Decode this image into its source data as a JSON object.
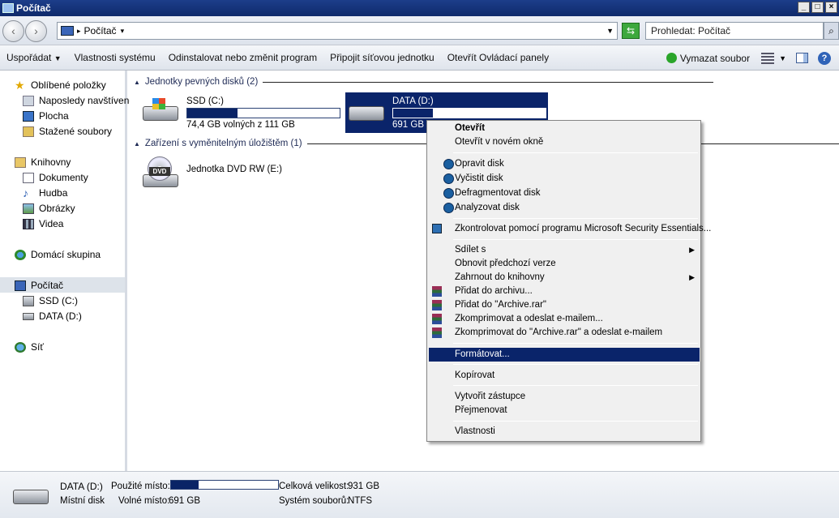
{
  "window": {
    "title": "Počítač"
  },
  "address": {
    "location": "Počítač",
    "search_placeholder": "Prohledat: Počítač"
  },
  "toolbar": {
    "organize": "Uspořádat",
    "system_props": "Vlastnosti systému",
    "uninstall": "Odinstalovat nebo změnit program",
    "map_drive": "Připojit síťovou jednotku",
    "control_panel": "Otevřít Ovládací panely",
    "erase": "Vymazat soubor"
  },
  "sidebar": {
    "favorites": "Oblíbené položky",
    "recent": "Naposledy navštívené",
    "desktop": "Plocha",
    "downloads": "Stažené soubory",
    "libraries": "Knihovny",
    "documents": "Dokumenty",
    "music": "Hudba",
    "pictures": "Obrázky",
    "videos": "Videa",
    "homegroup": "Domácí skupina",
    "computer": "Počítač",
    "ssd": "SSD (C:)",
    "data": "DATA (D:)",
    "network": "Síť"
  },
  "main": {
    "group_hdd": "Jednotky pevných disků (2)",
    "group_removable": "Zařízení s vyměnitelným úložištěm (1)",
    "drives": [
      {
        "name": "SSD (C:)",
        "free": "74,4 GB volných z 111 GB",
        "used_fraction": 0.33
      },
      {
        "name": "DATA (D:)",
        "free": "691 GB v",
        "used_fraction": 0.26
      },
      {
        "name": "Jednotka DVD RW (E:)"
      }
    ]
  },
  "context_menu": [
    {
      "label": "Otevřít",
      "bold": true
    },
    {
      "label": "Otevřít v novém okně"
    },
    {
      "label": "Opravit disk"
    },
    {
      "label": "Vyčistit disk"
    },
    {
      "label": "Defragmentovat disk"
    },
    {
      "label": "Analyzovat disk"
    },
    {
      "label": "Zkontrolovat pomocí programu Microsoft Security Essentials..."
    },
    {
      "label": "Sdílet s"
    },
    {
      "label": "Obnovit předchozí verze"
    },
    {
      "label": "Zahrnout do knihovny"
    },
    {
      "label": "Přidat do archivu..."
    },
    {
      "label": "Přidat do \"Archive.rar\""
    },
    {
      "label": "Zkomprimovat a odeslat e-mailem..."
    },
    {
      "label": "Zkomprimovat do \"Archive.rar\" a odeslat e-mailem"
    },
    {
      "label": "Formátovat...",
      "highlighted": true
    },
    {
      "label": "Kopírovat"
    },
    {
      "label": "Vytvořit zástupce"
    },
    {
      "label": "Přejmenovat"
    },
    {
      "label": "Vlastnosti"
    }
  ],
  "status": {
    "name": "DATA (D:)",
    "type": "Místní disk",
    "used_label": "Použité místo:",
    "free_label": "Volné místo:",
    "free_value": "691 GB",
    "total_label": "Celková velikost:",
    "total_value": "931 GB",
    "fs_label": "Systém souborů:",
    "fs_value": "NTFS",
    "used_fraction": 0.26
  },
  "colors": {
    "selection": "#0a246a",
    "titlebar": "#1c3e8a"
  }
}
